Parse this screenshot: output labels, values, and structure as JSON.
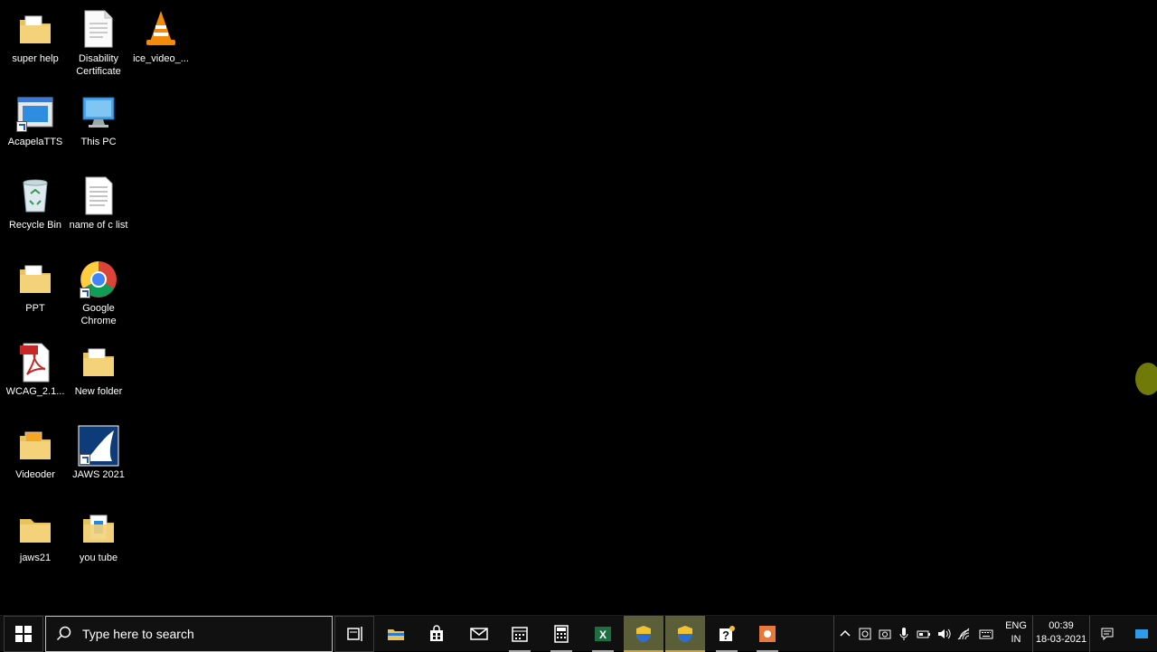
{
  "desktop": {
    "icons": [
      {
        "label": "super help",
        "icon": "folder-icon"
      },
      {
        "label": "Disability Certificate",
        "icon": "document-icon"
      },
      {
        "label": "ice_video_...",
        "icon": "vlc-cone-icon"
      },
      {
        "label": "AcapelaTTS",
        "icon": "app-window-icon"
      },
      {
        "label": "This PC",
        "icon": "computer-icon"
      },
      {
        "label": "Recycle Bin",
        "icon": "recycle-bin-icon"
      },
      {
        "label": "name of c list",
        "icon": "text-document-icon"
      },
      {
        "label": "PPT",
        "icon": "folder-icon"
      },
      {
        "label": "Google Chrome",
        "icon": "chrome-icon"
      },
      {
        "label": "WCAG_2.1...",
        "icon": "pdf-icon"
      },
      {
        "label": "New folder",
        "icon": "folder-icon"
      },
      {
        "label": "Videoder",
        "icon": "folder-icon"
      },
      {
        "label": "JAWS 2021",
        "icon": "jaws-shark-icon"
      },
      {
        "label": "jaws21",
        "icon": "folder-icon"
      },
      {
        "label": "you tube",
        "icon": "folder-icon"
      }
    ]
  },
  "taskbar": {
    "search_placeholder": "Type here to search",
    "apps": [
      {
        "name": "task-view",
        "icon": "task-view-icon"
      },
      {
        "name": "file-explorer",
        "icon": "folder-icon"
      },
      {
        "name": "store",
        "icon": "store-bag-icon"
      },
      {
        "name": "mail",
        "icon": "mail-icon"
      },
      {
        "name": "calendar",
        "icon": "calendar-icon"
      },
      {
        "name": "calculator",
        "icon": "calculator-icon"
      },
      {
        "name": "excel",
        "icon": "excel-icon"
      },
      {
        "name": "uac-prompt-1",
        "icon": "shield-icon"
      },
      {
        "name": "uac-prompt-2",
        "icon": "shield-icon"
      },
      {
        "name": "help",
        "icon": "help-icon"
      },
      {
        "name": "recorder",
        "icon": "recorder-icon"
      }
    ],
    "language": {
      "line1": "ENG",
      "line2": "IN"
    },
    "clock": {
      "time": "00:39",
      "date": "18-03-2021"
    }
  },
  "colors": {
    "background": "#000000",
    "taskbar": "#101010",
    "highlight": "#5a5f3a",
    "folder": "#e8c35a"
  }
}
